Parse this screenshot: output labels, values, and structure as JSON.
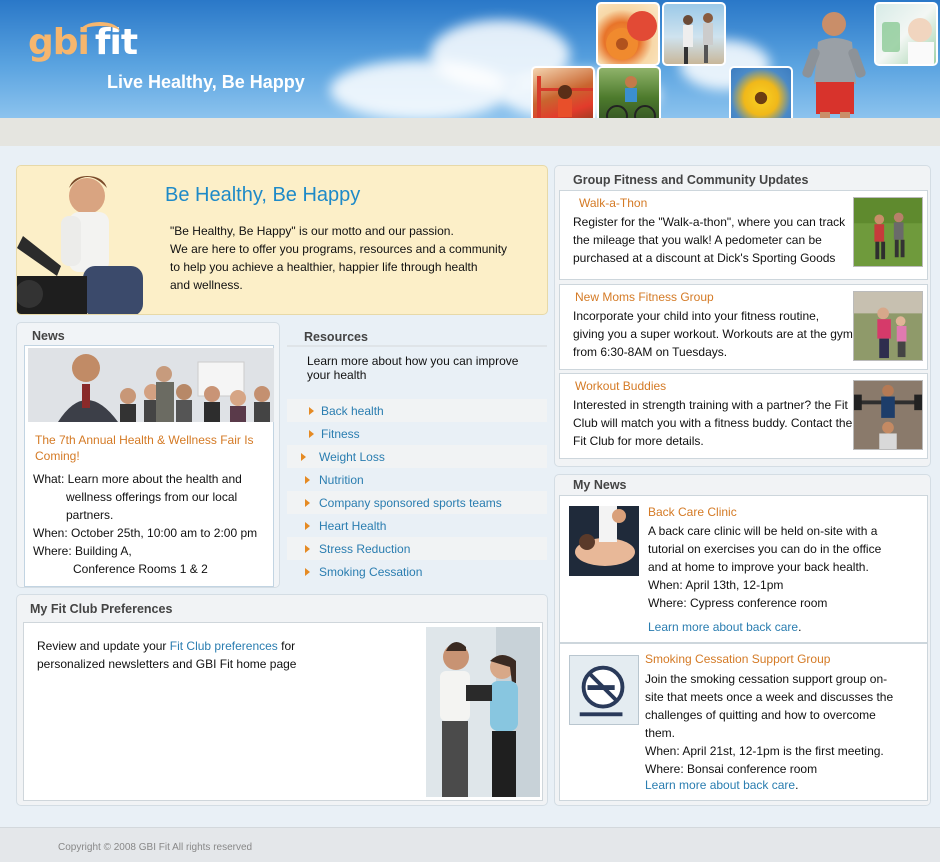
{
  "brand": {
    "logo_gbi": "gbi",
    "logo_fit": "fit",
    "tagline": "Live Healthy, Be Happy"
  },
  "hero": {
    "title": "Be Healthy, Be Happy",
    "line1": "\"Be Healthy, Be Happy\" is our motto and our passion.",
    "line2": "We are here to offer you programs, resources and a community",
    "line3": "to help you achieve a healthier, happier life through health",
    "line4": "and wellness."
  },
  "news": {
    "title": "News",
    "headline": "The 7th Annual Health & Wellness Fair Is Coming!",
    "what_1": "What: Learn more about  the health and",
    "what_2": "wellness offerings from our local",
    "what_3": "partners.",
    "when": "When: October 25th, 10:00 am to 2:00 pm",
    "where_1": "Where: Building A,",
    "where_2": "Conference Rooms 1 & 2"
  },
  "resources": {
    "title": "Resources",
    "intro": "Learn more about how you can improve your health",
    "items": [
      {
        "label": "Back health"
      },
      {
        "label": "Fitness"
      },
      {
        "label": "Weight Loss"
      },
      {
        "label": "Nutrition"
      },
      {
        "label": "Company sponsored sports teams"
      },
      {
        "label": "Heart Health"
      },
      {
        "label": "Stress Reduction"
      },
      {
        "label": "Smoking Cessation"
      }
    ]
  },
  "preferences": {
    "title": "My Fit Club Preferences",
    "text_before": "Review and update your ",
    "link": "Fit Club preferences",
    "text_after": " for personalized newsletters and GBI Fit home page"
  },
  "group_fitness": {
    "title": "Group Fitness and Community Updates",
    "items": [
      {
        "title": "Walk-a-Thon",
        "text": "Register for the \"Walk-a-thon\", where you can track the mileage that you walk!  A pedometer can be purchased at a discount at Dick's Sporting Goods"
      },
      {
        "title": "New Moms Fitness Group",
        "text": "Incorporate your child into your fitness routine, giving you a super workout.   Workouts are at the gym from 6:30-8AM on Tuesdays."
      },
      {
        "title": "Workout Buddies",
        "text": " Interested in strength training with a partner?  the  Fit Club will match you with a fitness buddy.  Contact the Fit Club for more details."
      }
    ]
  },
  "my_news": {
    "title": "My News",
    "items": [
      {
        "title": "Back Care Clinic",
        "text": "A back care clinic will be held on-site with a tutorial on exercises you can do in the office and at home to improve your back health.",
        "when": "When: April 13th, 12-1pm",
        "where": "Where: Cypress conference room",
        "link": "Learn more about back care",
        "link_suffix": "."
      },
      {
        "title": "Smoking Cessation Support Group",
        "text": "Join the smoking cessation support group on-site that meets once a week and discusses the challenges of quitting and how to overcome them.",
        "when": "When: April 21st, 12-1pm is the first meeting.",
        "where": "Where: Bonsai conference room",
        "link": "Learn more about back care",
        "link_suffix": "."
      }
    ]
  },
  "footer": {
    "copyright": "Copyright © 2008 GBI Fit  All rights reserved"
  },
  "colors": {
    "accent_blue": "#1e8ac8",
    "link_blue": "#2a7db0",
    "orange_heading": "#d47a25",
    "hero_bg": "#fcefc8"
  }
}
